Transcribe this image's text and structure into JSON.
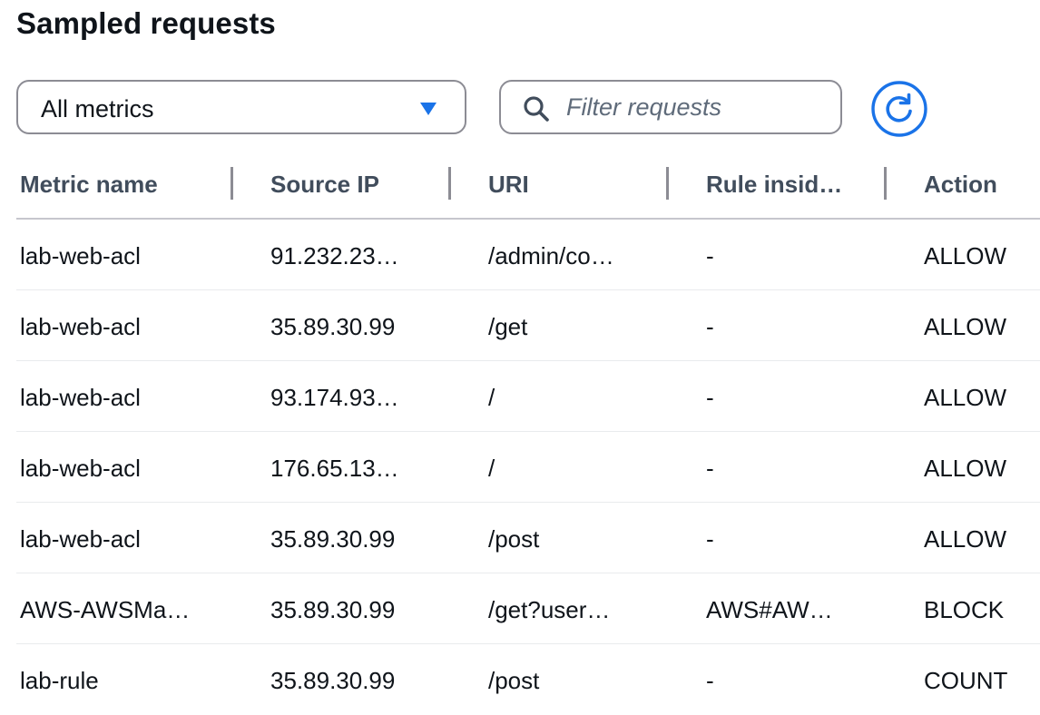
{
  "header": {
    "title": "Sampled requests"
  },
  "toolbar": {
    "metric_select": {
      "value": "All metrics",
      "icon": "caret-down-icon"
    },
    "filter": {
      "placeholder": "Filter requests",
      "icon": "search-icon"
    },
    "refresh": {
      "icon": "refresh-icon"
    }
  },
  "colors": {
    "accent": "#1a73e8",
    "border": "#8c8c94",
    "header_text": "#414d5c",
    "row_divider": "#e9ebed"
  },
  "table": {
    "columns": [
      {
        "label": "Metric name"
      },
      {
        "label": "Source IP"
      },
      {
        "label": "URI"
      },
      {
        "label": "Rule insid…"
      },
      {
        "label": "Action"
      }
    ],
    "rows": [
      {
        "metric": "lab-web-acl",
        "ip": "91.232.23…",
        "uri": "/admin/co…",
        "rule": "-",
        "action": "ALLOW"
      },
      {
        "metric": "lab-web-acl",
        "ip": "35.89.30.99",
        "uri": "/get",
        "rule": "-",
        "action": "ALLOW"
      },
      {
        "metric": "lab-web-acl",
        "ip": "93.174.93…",
        "uri": "/",
        "rule": "-",
        "action": "ALLOW"
      },
      {
        "metric": "lab-web-acl",
        "ip": "176.65.13…",
        "uri": "/",
        "rule": "-",
        "action": "ALLOW"
      },
      {
        "metric": "lab-web-acl",
        "ip": "35.89.30.99",
        "uri": "/post",
        "rule": "-",
        "action": "ALLOW"
      },
      {
        "metric": "AWS-AWSMa…",
        "ip": "35.89.30.99",
        "uri": "/get?user…",
        "rule": "AWS#AW…",
        "action": "BLOCK"
      },
      {
        "metric": "lab-rule",
        "ip": "35.89.30.99",
        "uri": "/post",
        "rule": "-",
        "action": "COUNT"
      }
    ]
  }
}
